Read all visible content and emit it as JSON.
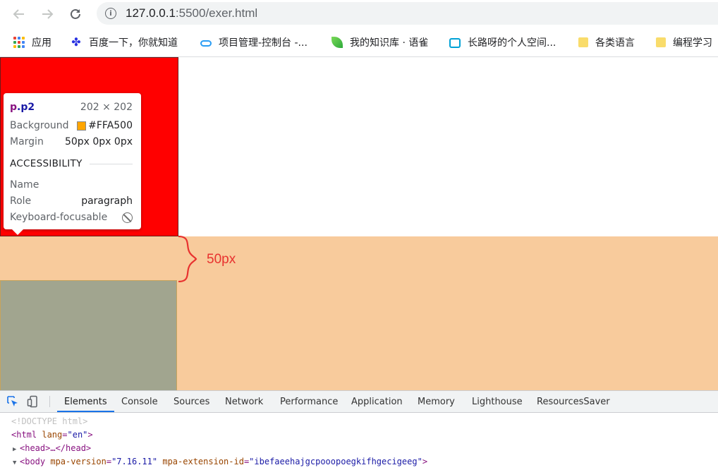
{
  "browser": {
    "url_host": "127.0.0.1",
    "url_path": ":5500/exer.html",
    "info_icon": "i"
  },
  "bookmarks": [
    {
      "label": "应用",
      "icon": "apps-grid-icon"
    },
    {
      "label": "百度一下，你就知道",
      "icon": "baidu-paw-icon"
    },
    {
      "label": "项目管理-控制台 -...",
      "icon": "cloud-icon"
    },
    {
      "label": "我的知识库 · 语雀",
      "icon": "yuque-leaf-icon"
    },
    {
      "label": "长路呀的个人空间...",
      "icon": "bilibili-tv-icon"
    },
    {
      "label": "各类语言",
      "icon": "folder-icon"
    },
    {
      "label": "编程学习",
      "icon": "folder-icon"
    }
  ],
  "page": {
    "margin_label": "50px",
    "colors": {
      "p1": "#ff0000",
      "band": "#f8cb9c",
      "p2": "#a1a58f",
      "brace": "#e8322f"
    }
  },
  "tooltip": {
    "tag": "p",
    "cls": ".p2",
    "size": "202 × 202",
    "background_label": "Background",
    "background_value": "#FFA500",
    "margin_label": "Margin",
    "margin_value": "50px 0px 0px",
    "section": "ACCESSIBILITY",
    "name_label": "Name",
    "name_value": "",
    "role_label": "Role",
    "role_value": "paragraph",
    "focus_label": "Keyboard-focusable"
  },
  "devtools": {
    "tabs": [
      "Elements",
      "Console",
      "Sources",
      "Network",
      "Performance",
      "Application",
      "Memory",
      "Lighthouse",
      "ResourcesSaver"
    ],
    "active_tab": "Elements",
    "dom": {
      "doctype": "<!DOCTYPE html>",
      "html_open": "<html",
      "lang_attr": "lang",
      "lang_val": "\"en\"",
      "close_bracket": ">",
      "head": "<head>…</head>",
      "body_open": "<body",
      "body_attr1": "mpa-version",
      "body_val1": "\"7.16.11\"",
      "body_attr2": "mpa-extension-id",
      "body_val2": "\"ibefaeehajgcpooopoegkifhgecigeeg\"",
      "expand_collapsed": "▶",
      "expand_open": "▼",
      "eq": "="
    }
  }
}
